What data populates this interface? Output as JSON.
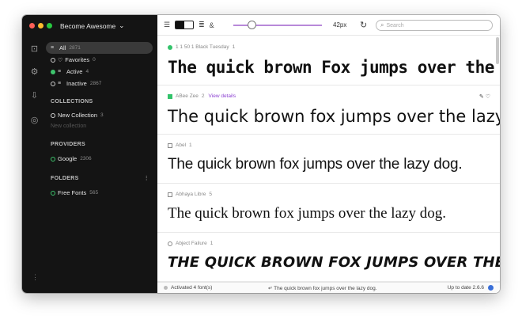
{
  "window": {
    "title": "Become Awesome"
  },
  "sidebar": {
    "library": [
      {
        "label": "All",
        "count": "2871"
      },
      {
        "label": "Favorites",
        "count": "0"
      },
      {
        "label": "Active",
        "count": "4"
      },
      {
        "label": "Inactive",
        "count": "2867"
      }
    ],
    "collections_heading": "COLLECTIONS",
    "collections": [
      {
        "label": "New Collection",
        "count": "3"
      }
    ],
    "new_collection_placeholder": "New collection",
    "providers_heading": "PROVIDERS",
    "providers": [
      {
        "label": "Google",
        "count": "2306"
      }
    ],
    "folders_heading": "FOLDERS",
    "folders": [
      {
        "label": "Free Fonts",
        "count": "565"
      }
    ]
  },
  "toolbar": {
    "size_label": "42px",
    "search_placeholder": "Search",
    "size_slider_level": 0.16
  },
  "fonts": [
    {
      "name": "1 1 50 1 Black Tuesday",
      "count": "1",
      "status": "active",
      "sample": "The quick brown Fox jumps over the lazy dog"
    },
    {
      "name": "ABee Zee",
      "count": "2",
      "status": "active",
      "view_details": "View details",
      "sample": "The quick brown fox jumps over the lazy dog."
    },
    {
      "name": "Abel",
      "count": "1",
      "status": "inactive",
      "sample": "The quick brown fox jumps over the lazy dog."
    },
    {
      "name": "Abhaya Libre",
      "count": "5",
      "status": "inactive",
      "sample": "The quick brown fox jumps over the lazy dog."
    },
    {
      "name": "Abject Failure",
      "count": "1",
      "status": "inactive",
      "sample": "The quick brown fox jumps over the lazy dog"
    }
  ],
  "status_bar": {
    "activated": "Activated 4 font(s)",
    "preview_text": "The quick brown fox jumps over the lazy dog.",
    "update": "Up to date 2.6.6"
  },
  "colors": {
    "sidebar_bg": "#141414",
    "accent_purple": "#8b3fd1",
    "active_green": "#33c36b"
  }
}
